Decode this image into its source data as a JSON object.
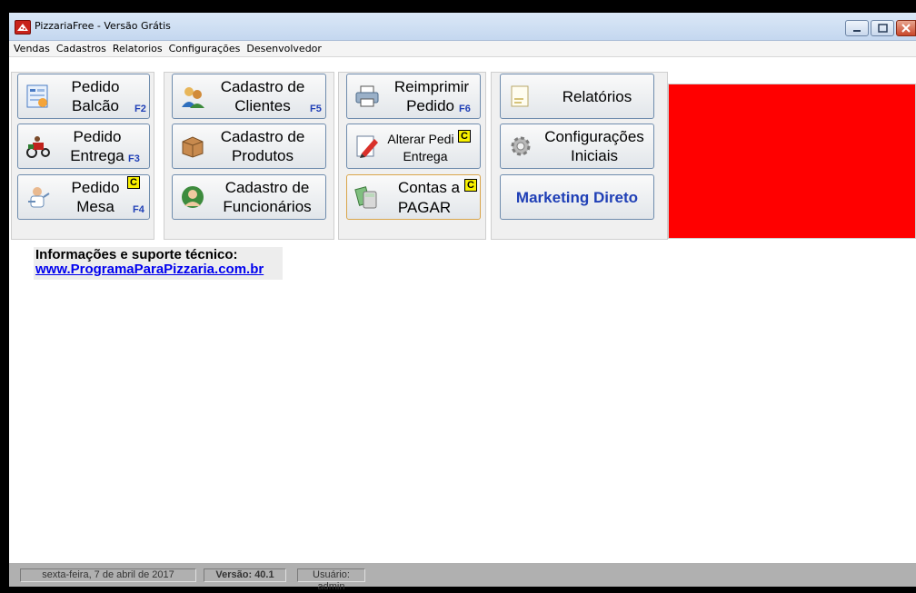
{
  "window": {
    "title": "PizzariaFree - Versão Grátis"
  },
  "menu": [
    "Vendas",
    "Cadastros",
    "Relatorios",
    "Configurações",
    "Desenvolvedor"
  ],
  "buttons": {
    "pedido_balcao": {
      "line1": "Pedido",
      "line2": "Balcão",
      "key": "F2"
    },
    "pedido_entrega": {
      "line1": "Pedido",
      "line2": "Entrega",
      "key": "F3"
    },
    "pedido_mesa": {
      "line1": "Pedido",
      "line2": "Mesa",
      "key": "F4",
      "badge": "C"
    },
    "cadastro_clientes": {
      "line1": "Cadastro de",
      "line2": "Clientes",
      "key": "F5"
    },
    "cadastro_produtos": {
      "line1": "Cadastro de",
      "line2": "Produtos"
    },
    "cadastro_funcionarios": {
      "line1": "Cadastro de",
      "line2": "Funcionários"
    },
    "reimprimir": {
      "line1": "Reimprimir",
      "line2": "Pedido",
      "key": "F6"
    },
    "alterar": {
      "line1": "Alterar Pedi",
      "line2": "Entrega",
      "badge": "C"
    },
    "contas": {
      "line1": "Contas a",
      "line2": "PAGAR",
      "badge": "C"
    },
    "relatorios": {
      "label": "Relatórios"
    },
    "configuracoes": {
      "line1": "Configurações",
      "line2": "Iniciais"
    },
    "marketing": {
      "label": "Marketing Direto"
    }
  },
  "info": {
    "title": "Informações e suporte técnico:",
    "link": "www.ProgramaParaPizzaria.com.br"
  },
  "status": {
    "date": "sexta-feira, 7 de abril de 2017",
    "version": "Versão: 40.1",
    "user": "Usuário: admin"
  },
  "colors": {
    "red_panel": "#ff0000",
    "key_blue": "#1f3fb6",
    "badge_yellow": "#f8f000",
    "marketing_blue": "#1f3fb6"
  }
}
